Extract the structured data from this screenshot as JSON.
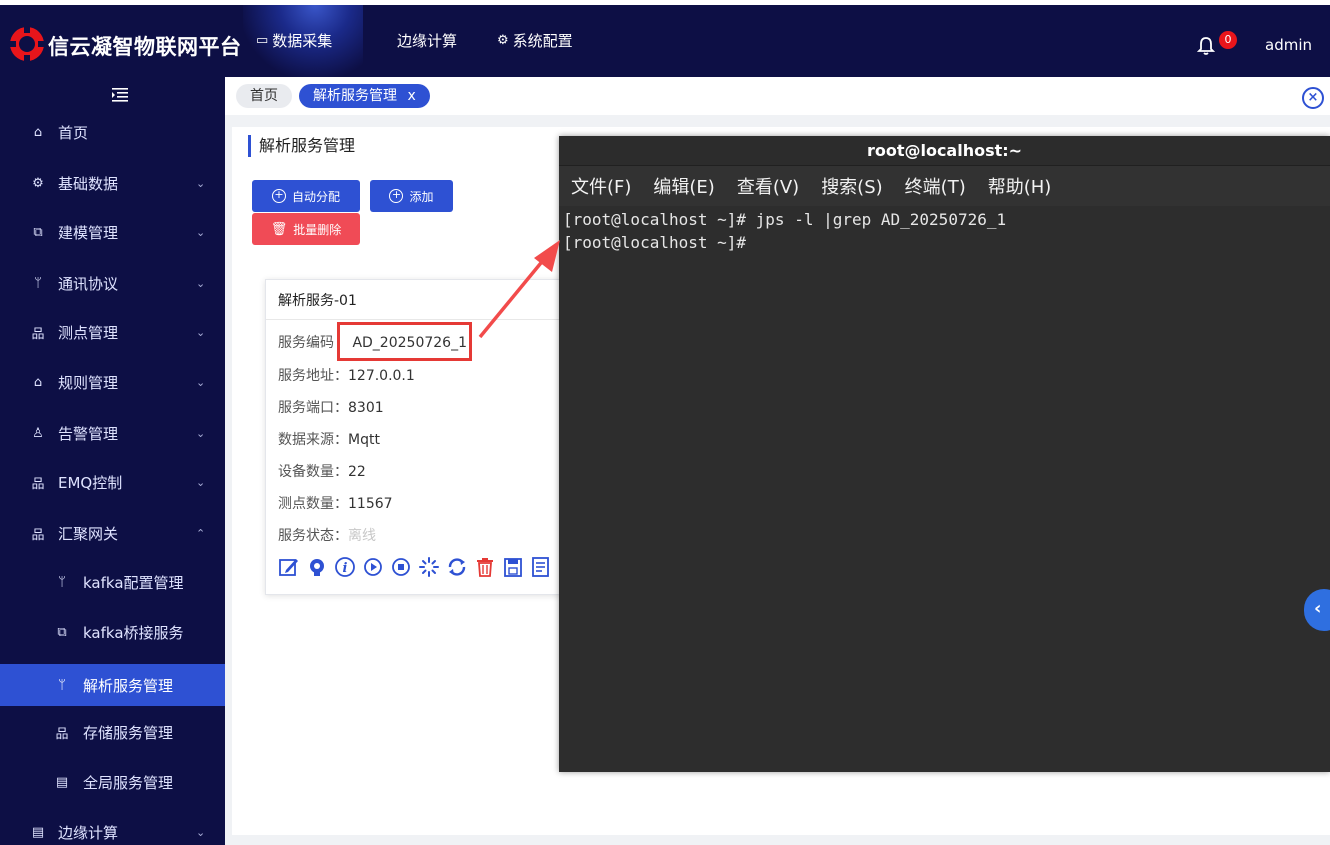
{
  "header": {
    "brand": "信云凝智物联网平台",
    "nav": [
      {
        "label": "数据采集",
        "icon": "monitor-icon"
      },
      {
        "label": "边缘计算"
      },
      {
        "label": "系统配置",
        "icon": "gear-icon"
      }
    ],
    "notifications": "0",
    "user": "admin"
  },
  "sidebar": {
    "items": [
      {
        "label": "首页",
        "icon": "home-icon"
      },
      {
        "label": "基础数据",
        "icon": "gear-icon"
      },
      {
        "label": "建模管理",
        "icon": "copy-icon"
      },
      {
        "label": "通讯协议",
        "icon": "branch-icon"
      },
      {
        "label": "测点管理",
        "icon": "network-icon"
      },
      {
        "label": "规则管理",
        "icon": "home-icon"
      },
      {
        "label": "告警管理",
        "icon": "user-icon"
      },
      {
        "label": "EMQ控制",
        "icon": "network-icon"
      },
      {
        "label": "汇聚网关",
        "icon": "network-icon"
      },
      {
        "label": "kafka配置管理",
        "icon": "branch-icon"
      },
      {
        "label": "kafka桥接服务",
        "icon": "copy-icon"
      },
      {
        "label": "解析服务管理",
        "icon": "branch-icon"
      },
      {
        "label": "存储服务管理",
        "icon": "network-icon"
      },
      {
        "label": "全局服务管理",
        "icon": "list-icon"
      },
      {
        "label": "边缘计算",
        "icon": "list-icon"
      }
    ]
  },
  "tabs": {
    "home": "首页",
    "current": "解析服务管理",
    "close": "x"
  },
  "panel": {
    "title": "解析服务管理",
    "buttons": {
      "auto_assign": "自动分配",
      "add": "添加",
      "batch_delete": "批量删除"
    }
  },
  "card": {
    "title": "解析服务-01",
    "rows": [
      {
        "label": "服务编码",
        "value": "AD_20250726_1"
      },
      {
        "label": "服务地址：",
        "value": "127.0.0.1"
      },
      {
        "label": "服务端口：",
        "value": "8301"
      },
      {
        "label": "数据来源：",
        "value": "Mqtt"
      },
      {
        "label": "设备数量：",
        "value": "22"
      },
      {
        "label": "测点数量：",
        "value": "11567"
      },
      {
        "label": "服务状态：",
        "value": "离线"
      }
    ]
  },
  "terminal": {
    "title": "root@localhost:~",
    "menu": [
      "文件(F)",
      "编辑(E)",
      "查看(V)",
      "搜索(S)",
      "终端(T)",
      "帮助(H)"
    ],
    "lines": [
      "[root@localhost ~]# jps -l |grep AD_20250726_1",
      "[root@localhost ~]#"
    ]
  },
  "colors": {
    "nav_bg": "#0d0f45",
    "accent": "#2e51d3",
    "danger": "#f04b56",
    "highlight": "#e53935",
    "terminal_bg": "#2d2d2d"
  }
}
